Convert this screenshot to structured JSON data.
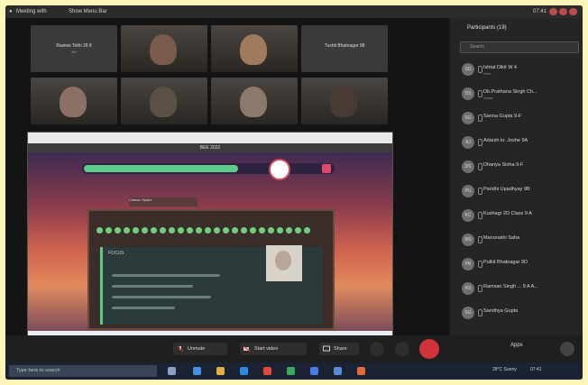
{
  "titlebar": {
    "app": "Meeting with",
    "meeting": "Show Menu Bar",
    "time": "07:41"
  },
  "video_tiles": [
    {
      "name": "Rasiwe Tethi 28 8",
      "sub": "Rd",
      "kind": "name"
    },
    {
      "name": "",
      "kind": "person",
      "tone": "#7a5a4a"
    },
    {
      "name": "",
      "kind": "person",
      "tone": "#a07a5a"
    },
    {
      "name": "Tushti Bhatnagar 98",
      "kind": "name"
    },
    {
      "name": "",
      "kind": "person",
      "tone": "#8a7065"
    },
    {
      "name": "",
      "kind": "person",
      "tone": "#5a5045"
    },
    {
      "name": "",
      "kind": "person",
      "tone": "#8a7a6c"
    },
    {
      "name": "",
      "kind": "person",
      "tone": "#4a3a34"
    }
  ],
  "shared": {
    "toolbar_label": "BEE 2022",
    "board_tabs": "Classic   Space",
    "inner_label": "FOCUS",
    "progress": 0.62
  },
  "participants": {
    "title": "Participants (19)",
    "search_placeholder": "Search",
    "people": [
      {
        "initials": "SD",
        "name": "Ishtat Dikit W 4",
        "sub": "Host"
      },
      {
        "initials": "DS",
        "name": "Db.Prathana Singh Ch...",
        "sub": "Guest"
      },
      {
        "initials": "SG",
        "name": "Sanna Gupta 9-F",
        "sub": ""
      },
      {
        "initials": "AJ",
        "name": "Adarsh kr. Joshe 9A",
        "sub": ""
      },
      {
        "initials": "DS",
        "name": "Dhanya Sinha  9-F",
        "sub": ""
      },
      {
        "initials": "PU",
        "name": "Paridhi Upadhyay 9B",
        "sub": ""
      },
      {
        "initials": "KC",
        "name": "Kushagr 2D Class 9 A",
        "sub": ""
      },
      {
        "initials": "MS",
        "name": "Manorakhi Saha",
        "sub": ""
      },
      {
        "initials": "PB",
        "name": "Pulkit Bhatnagar 9D",
        "sub": ""
      },
      {
        "initials": "RS",
        "name": "Ramsan Singh ... 9 A A...",
        "sub": ""
      },
      {
        "initials": "SG",
        "name": "Sandhya Gupta",
        "sub": ""
      }
    ]
  },
  "controls": {
    "unmute": "Unmute",
    "start_video": "Start video",
    "share": "Share",
    "apps": "Apps"
  },
  "taskbar": {
    "search_placeholder": "Type here to search",
    "weather": "28°C Sunny",
    "clock": "07:41"
  },
  "colors": {
    "accent_green": "#5ecb8a",
    "end_red": "#d13438",
    "frame_yellow": "#fdf6b8"
  }
}
